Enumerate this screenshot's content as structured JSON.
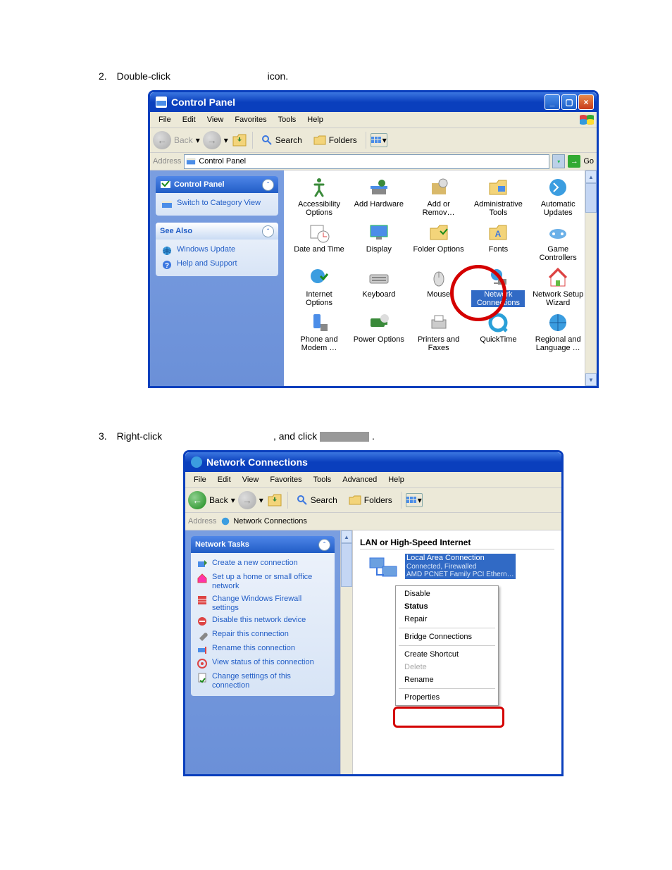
{
  "step2": {
    "number": "2.",
    "prefix": "Double-click",
    "suffix": "icon."
  },
  "step3": {
    "number": "3.",
    "prefix": "Right-click",
    "middle": ", and click",
    "suffix": "."
  },
  "cp": {
    "title": "Control Panel",
    "menu": [
      "File",
      "Edit",
      "View",
      "Favorites",
      "Tools",
      "Help"
    ],
    "toolbar": {
      "back": "Back",
      "search": "Search",
      "folders": "Folders"
    },
    "address_label": "Address",
    "address_value": "Control Panel",
    "go": "Go",
    "side": {
      "group1_title": "Control Panel",
      "switch_view": "Switch to Category View",
      "group2_title": "See Also",
      "links": [
        "Windows Update",
        "Help and Support"
      ]
    },
    "items": [
      "Accessibility Options",
      "Add Hardware",
      "Add or Remov…",
      "Administrative Tools",
      "Automatic Updates",
      "Date and Time",
      "Display",
      "Folder Options",
      "Fonts",
      "Game Controllers",
      "Internet Options",
      "Keyboard",
      "Mouse",
      "Network Connections",
      "Network Setup Wizard",
      "Phone and Modem …",
      "Power Options",
      "Printers and Faxes",
      "QuickTime",
      "Regional and Language …"
    ]
  },
  "nc": {
    "title": "Network Connections",
    "menu": [
      "File",
      "Edit",
      "View",
      "Favorites",
      "Tools",
      "Advanced",
      "Help"
    ],
    "toolbar": {
      "back": "Back",
      "search": "Search",
      "folders": "Folders"
    },
    "address_label": "Address",
    "address_value": "Network Connections",
    "tasks_title": "Network Tasks",
    "tasks": [
      "Create a new connection",
      "Set up a home or small office network",
      "Change Windows Firewall settings",
      "Disable this network device",
      "Repair this connection",
      "Rename this connection",
      "View status of this connection",
      "Change settings of this connection"
    ],
    "category": "LAN or High-Speed Internet",
    "conn": {
      "name": "Local Area Connection",
      "status": "Connected, Firewalled",
      "device": "AMD PCNET Family PCI Ethern…"
    },
    "ctx": {
      "disable": "Disable",
      "status": "Status",
      "repair": "Repair",
      "bridge": "Bridge Connections",
      "shortcut": "Create Shortcut",
      "delete": "Delete",
      "rename": "Rename",
      "properties": "Properties"
    }
  }
}
